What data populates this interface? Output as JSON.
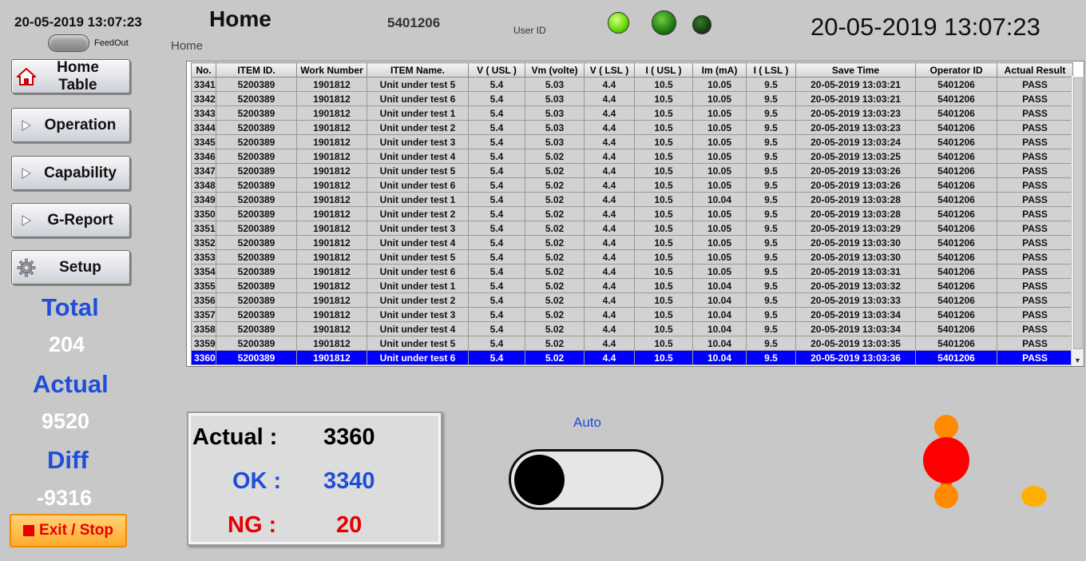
{
  "header": {
    "datetime_small": "20-05-2019  13:07:23",
    "feedout_label": "FeedOut",
    "title": "Home",
    "breadcrumb": "Home",
    "operator_id": "5401206",
    "user_id_label": "User ID",
    "datetime_large": "20-05-2019  13:07:23"
  },
  "indicators": {
    "led_colors": [
      "#5fd800",
      "#1f7a10",
      "#123d0c"
    ]
  },
  "nav": {
    "home_table": "Home Table",
    "operation": "Operation",
    "capability": "Capability",
    "greport": "G-Report",
    "setup": "Setup"
  },
  "stats": {
    "total_label": "Total",
    "total_value": "204",
    "actual_label": "Actual",
    "actual_value": "9520",
    "diff_label": "Diff",
    "diff_value": "-9316"
  },
  "exit_label": "Exit /  Stop",
  "table": {
    "columns": [
      "No.",
      "ITEM ID.",
      "Work Number",
      "ITEM Name.",
      "V ( USL )",
      "Vm (volte)",
      "V ( LSL )",
      "I ( USL )",
      "Im (mA)",
      "I ( LSL )",
      "Save Time",
      "Operator ID",
      "Actual Result"
    ],
    "rows": [
      [
        "3341",
        "5200389",
        "1901812",
        "Unit under test 5",
        "5.4",
        "5.03",
        "4.4",
        "10.5",
        "10.05",
        "9.5",
        "20-05-2019  13:03:21",
        "5401206",
        "PASS"
      ],
      [
        "3342",
        "5200389",
        "1901812",
        "Unit under test 6",
        "5.4",
        "5.03",
        "4.4",
        "10.5",
        "10.05",
        "9.5",
        "20-05-2019  13:03:21",
        "5401206",
        "PASS"
      ],
      [
        "3343",
        "5200389",
        "1901812",
        "Unit under test 1",
        "5.4",
        "5.03",
        "4.4",
        "10.5",
        "10.05",
        "9.5",
        "20-05-2019  13:03:23",
        "5401206",
        "PASS"
      ],
      [
        "3344",
        "5200389",
        "1901812",
        "Unit under test 2",
        "5.4",
        "5.03",
        "4.4",
        "10.5",
        "10.05",
        "9.5",
        "20-05-2019  13:03:23",
        "5401206",
        "PASS"
      ],
      [
        "3345",
        "5200389",
        "1901812",
        "Unit under test 3",
        "5.4",
        "5.03",
        "4.4",
        "10.5",
        "10.05",
        "9.5",
        "20-05-2019  13:03:24",
        "5401206",
        "PASS"
      ],
      [
        "3346",
        "5200389",
        "1901812",
        "Unit under test 4",
        "5.4",
        "5.02",
        "4.4",
        "10.5",
        "10.05",
        "9.5",
        "20-05-2019  13:03:25",
        "5401206",
        "PASS"
      ],
      [
        "3347",
        "5200389",
        "1901812",
        "Unit under test 5",
        "5.4",
        "5.02",
        "4.4",
        "10.5",
        "10.05",
        "9.5",
        "20-05-2019  13:03:26",
        "5401206",
        "PASS"
      ],
      [
        "3348",
        "5200389",
        "1901812",
        "Unit under test 6",
        "5.4",
        "5.02",
        "4.4",
        "10.5",
        "10.05",
        "9.5",
        "20-05-2019  13:03:26",
        "5401206",
        "PASS"
      ],
      [
        "3349",
        "5200389",
        "1901812",
        "Unit under test 1",
        "5.4",
        "5.02",
        "4.4",
        "10.5",
        "10.04",
        "9.5",
        "20-05-2019  13:03:28",
        "5401206",
        "PASS"
      ],
      [
        "3350",
        "5200389",
        "1901812",
        "Unit under test 2",
        "5.4",
        "5.02",
        "4.4",
        "10.5",
        "10.05",
        "9.5",
        "20-05-2019  13:03:28",
        "5401206",
        "PASS"
      ],
      [
        "3351",
        "5200389",
        "1901812",
        "Unit under test 3",
        "5.4",
        "5.02",
        "4.4",
        "10.5",
        "10.05",
        "9.5",
        "20-05-2019  13:03:29",
        "5401206",
        "PASS"
      ],
      [
        "3352",
        "5200389",
        "1901812",
        "Unit under test 4",
        "5.4",
        "5.02",
        "4.4",
        "10.5",
        "10.05",
        "9.5",
        "20-05-2019  13:03:30",
        "5401206",
        "PASS"
      ],
      [
        "3353",
        "5200389",
        "1901812",
        "Unit under test 5",
        "5.4",
        "5.02",
        "4.4",
        "10.5",
        "10.05",
        "9.5",
        "20-05-2019  13:03:30",
        "5401206",
        "PASS"
      ],
      [
        "3354",
        "5200389",
        "1901812",
        "Unit under test 6",
        "5.4",
        "5.02",
        "4.4",
        "10.5",
        "10.05",
        "9.5",
        "20-05-2019  13:03:31",
        "5401206",
        "PASS"
      ],
      [
        "3355",
        "5200389",
        "1901812",
        "Unit under test 1",
        "5.4",
        "5.02",
        "4.4",
        "10.5",
        "10.04",
        "9.5",
        "20-05-2019  13:03:32",
        "5401206",
        "PASS"
      ],
      [
        "3356",
        "5200389",
        "1901812",
        "Unit under test 2",
        "5.4",
        "5.02",
        "4.4",
        "10.5",
        "10.04",
        "9.5",
        "20-05-2019  13:03:33",
        "5401206",
        "PASS"
      ],
      [
        "3357",
        "5200389",
        "1901812",
        "Unit under test 3",
        "5.4",
        "5.02",
        "4.4",
        "10.5",
        "10.04",
        "9.5",
        "20-05-2019  13:03:34",
        "5401206",
        "PASS"
      ],
      [
        "3358",
        "5200389",
        "1901812",
        "Unit under test 4",
        "5.4",
        "5.02",
        "4.4",
        "10.5",
        "10.04",
        "9.5",
        "20-05-2019  13:03:34",
        "5401206",
        "PASS"
      ],
      [
        "3359",
        "5200389",
        "1901812",
        "Unit under test 5",
        "5.4",
        "5.02",
        "4.4",
        "10.5",
        "10.04",
        "9.5",
        "20-05-2019  13:03:35",
        "5401206",
        "PASS"
      ],
      [
        "3360",
        "5200389",
        "1901812",
        "Unit under test 6",
        "5.4",
        "5.02",
        "4.4",
        "10.5",
        "10.04",
        "9.5",
        "20-05-2019  13:03:36",
        "5401206",
        "PASS"
      ]
    ],
    "selected_row": "3360"
  },
  "summary": {
    "actual_label": "Actual :",
    "actual_value": "3360",
    "ok_label": "OK :",
    "ok_value": "3340",
    "ng_label": "NG :",
    "ng_value": "20"
  },
  "mode": {
    "label": "Auto"
  }
}
